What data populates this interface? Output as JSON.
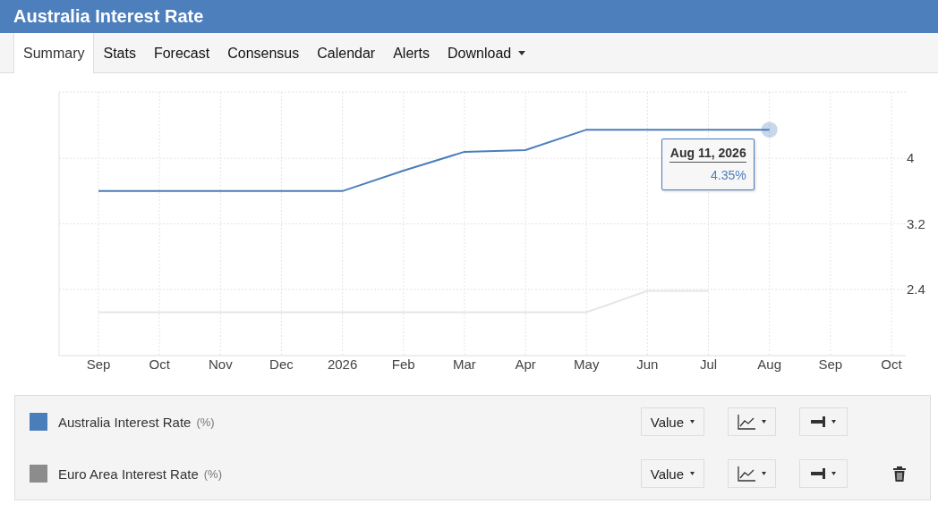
{
  "window": {
    "title": "Australia Interest Rate"
  },
  "tabs": [
    {
      "label": "Summary",
      "selected": true,
      "dropdown": false
    },
    {
      "label": "Stats",
      "selected": false,
      "dropdown": false
    },
    {
      "label": "Forecast",
      "selected": false,
      "dropdown": false
    },
    {
      "label": "Consensus",
      "selected": false,
      "dropdown": false
    },
    {
      "label": "Calendar",
      "selected": false,
      "dropdown": false
    },
    {
      "label": "Alerts",
      "selected": false,
      "dropdown": false
    },
    {
      "label": "Download",
      "selected": false,
      "dropdown": true
    }
  ],
  "chart": {
    "chart_data": {
      "type": "line",
      "categories": [
        "Sep",
        "Oct",
        "Nov",
        "Dec",
        "2026",
        "Feb",
        "Mar",
        "Apr",
        "May",
        "Jun",
        "Jul",
        "Aug",
        "Sep",
        "Oct"
      ],
      "yticks": [
        2.4,
        3.2,
        4
      ],
      "grid": true,
      "ylim": [
        1.59,
        4.81
      ],
      "series": [
        {
          "name": "Australia Interest Rate",
          "color": "#4a7ebb",
          "values": [
            3.6,
            3.6,
            3.6,
            3.6,
            3.6,
            3.85,
            4.08,
            4.1,
            4.35,
            4.35,
            4.35,
            4.35,
            null,
            null
          ]
        },
        {
          "name": "Euro Area Interest Rate",
          "color": "#e6e6e6",
          "values": [
            2.12,
            2.12,
            2.12,
            2.12,
            2.12,
            2.12,
            2.12,
            2.12,
            2.12,
            2.38,
            2.38,
            null,
            null,
            null
          ]
        }
      ]
    },
    "tooltip": {
      "date": "Aug 11, 2026",
      "value": "4.35%"
    }
  },
  "legend": [
    {
      "unit": "(%)",
      "color": "#4a7ebb",
      "value_button": "Value",
      "removable": false
    },
    {
      "unit": "(%)",
      "color": "#8c8c8c",
      "value_button": "Value",
      "removable": true
    }
  ]
}
